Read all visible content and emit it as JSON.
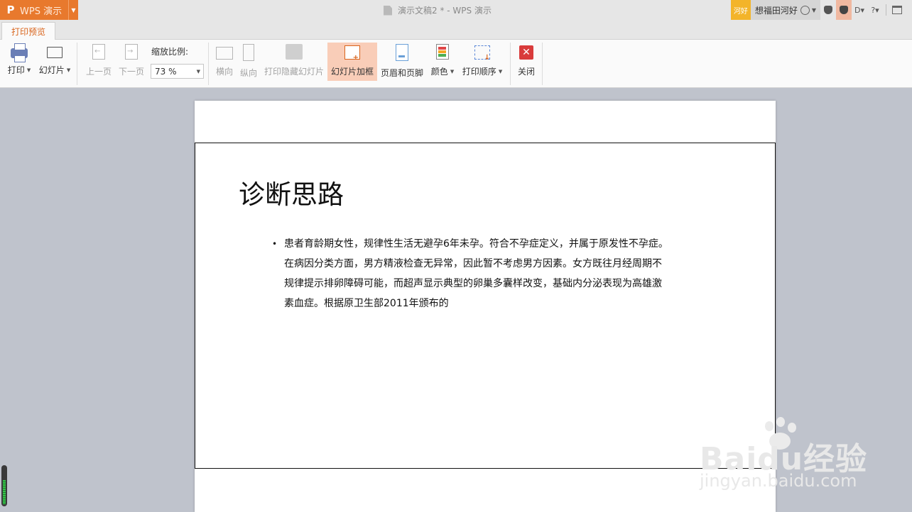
{
  "app": {
    "name": "WPS 演示",
    "logo": "P"
  },
  "window": {
    "title": "演示文稿2 * - WPS 演示"
  },
  "user": {
    "badge": "河好",
    "name": "想福田河好"
  },
  "tabs": [
    {
      "label": "打印预览",
      "active": true
    }
  ],
  "ribbon": {
    "print": "打印",
    "slides": "幻灯片",
    "prev_page": "上一页",
    "next_page": "下一页",
    "zoom_label": "缩放比例:",
    "zoom_value": "73 %",
    "landscape": "横向",
    "portrait": "纵向",
    "print_hidden": "打印隐藏幻灯片",
    "slide_frame": "幻灯片加框",
    "header_footer": "页眉和页脚",
    "color": "颜色",
    "print_order": "打印顺序",
    "close": "关闭"
  },
  "slide": {
    "title": "诊断思路",
    "bullet": "•",
    "lines": [
      "患者育龄期女性，规律性生活无避孕6年未孕。符合不孕症定义，并属于原发性不孕症。",
      "在病因分类方面，男方精液检查无异常，因此暂不考虑男方因素。女方既往月经周期不",
      "规律提示排卵障碍可能，而超声显示典型的卵巢多囊样改变，基础内分泌表现为高雄激",
      "素血症。根据原卫生部2011年颁布的"
    ]
  },
  "watermark": {
    "logo": "Baidu经验",
    "url": "jingyan.baidu.com"
  },
  "colors": {
    "accent": "#e8792d",
    "active_tab_text": "#d9641c",
    "active_button": "#f9cdb8",
    "close_red": "#d93b3b"
  }
}
